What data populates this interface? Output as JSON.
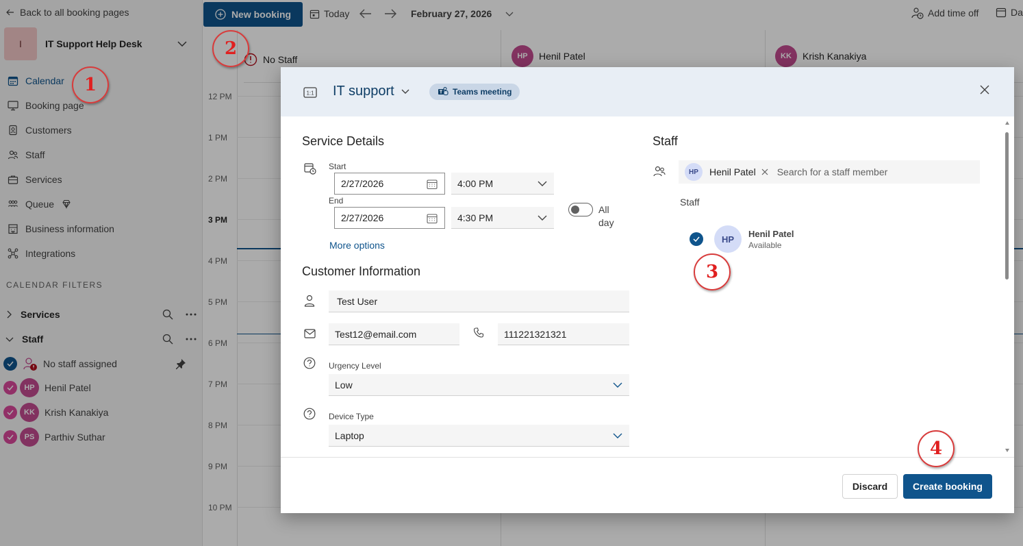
{
  "sidebar": {
    "back_label": "Back to all booking pages",
    "org_initial": "I",
    "org_name": "IT Support Help Desk",
    "nav": [
      {
        "label": "Calendar",
        "icon": "calendar-icon"
      },
      {
        "label": "Booking page",
        "icon": "monitor-icon"
      },
      {
        "label": "Customers",
        "icon": "contact-card-icon"
      },
      {
        "label": "Staff",
        "icon": "people-icon"
      },
      {
        "label": "Services",
        "icon": "briefcase-icon"
      },
      {
        "label": "Queue",
        "icon": "queue-icon"
      },
      {
        "label": "Business information",
        "icon": "building-icon"
      },
      {
        "label": "Integrations",
        "icon": "integrations-icon"
      }
    ],
    "filters_heading": "CALENDAR FILTERS",
    "filter_services": "Services",
    "filter_staff": "Staff",
    "staff": [
      {
        "name": "No staff assigned"
      },
      {
        "initials": "HP",
        "name": "Henil Patel"
      },
      {
        "initials": "KK",
        "name": "Krish Kanakiya"
      },
      {
        "initials": "PS",
        "name": "Parthiv Suthar"
      }
    ]
  },
  "topbar": {
    "new_booking": "New booking",
    "today": "Today",
    "date": "February 27, 2026",
    "add_time_off": "Add time off",
    "cut_label": "Da"
  },
  "calendar": {
    "columns": [
      {
        "label": "No Staff"
      },
      {
        "initials": "HP",
        "label": "Henil Patel"
      },
      {
        "initials": "KK",
        "label": "Krish Kanakiya"
      }
    ],
    "times": [
      "12 PM",
      "1 PM",
      "2 PM",
      "3 PM",
      "4 PM",
      "5 PM",
      "6 PM",
      "7 PM",
      "8 PM",
      "9 PM",
      "10 PM"
    ]
  },
  "dialog": {
    "service": "IT support",
    "teams_label": "Teams meeting",
    "service_details": "Service Details",
    "start_label": "Start",
    "start_date": "2/27/2026",
    "start_time": "4:00 PM",
    "end_label": "End",
    "end_date": "2/27/2026",
    "end_time": "4:30 PM",
    "all_day": "All day",
    "more_options": "More options",
    "customer_info": "Customer Information",
    "customer_name": "Test User",
    "customer_email": "Test12@email.com",
    "customer_phone": "111221321321",
    "urgency_label": "Urgency Level",
    "urgency_value": "Low",
    "device_label": "Device Type",
    "device_value": "Laptop",
    "staff_heading": "Staff",
    "staff_pill_initials": "HP",
    "staff_pill_name": "Henil Patel",
    "staff_search_placeholder": "Search for a staff member",
    "staff_sub": "Staff",
    "candidate_initials": "HP",
    "candidate_name": "Henil Patel",
    "candidate_status": "Available",
    "discard": "Discard",
    "create": "Create booking"
  },
  "annotations": [
    "1",
    "2",
    "3",
    "4"
  ]
}
